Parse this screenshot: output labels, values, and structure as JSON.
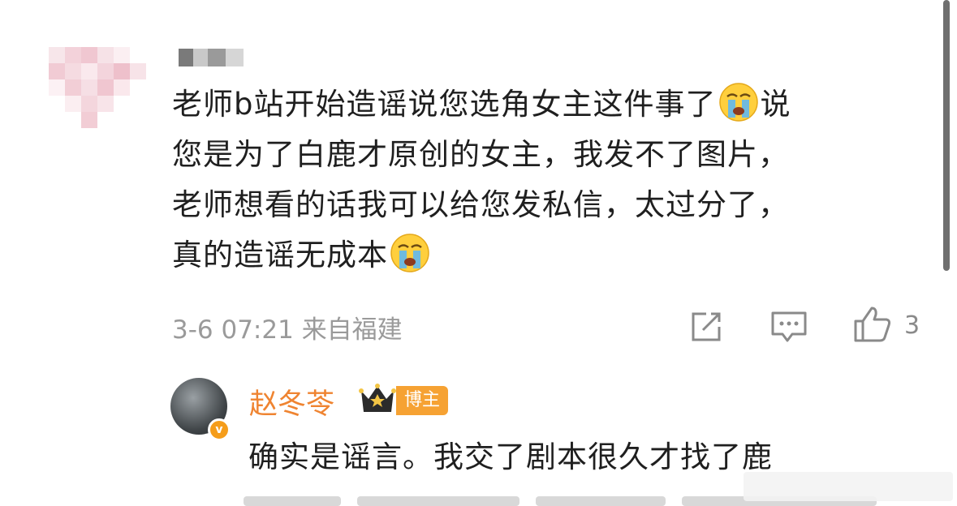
{
  "comment": {
    "text_1": "老师b站开始造谣说您选角女主这件事了",
    "text_2": "说",
    "text_3": "您是为了白鹿才原创的女主，我发不了图片，",
    "text_4": "老师想看的话我可以给您发私信，太过分了，",
    "text_5": "真的造谣无成本",
    "emoji_icon": "crying-face-icon",
    "timestamp": "3-6 07:21",
    "location": "来自福建",
    "like_count": "3"
  },
  "reply": {
    "author": "赵冬苓",
    "badge": "博主",
    "text": "确实是谣言。我交了剧本很久才找了鹿"
  },
  "colors": {
    "author_name": "#ef8431",
    "badge_bg": "#f6a233",
    "meta_text": "#9a9a9a"
  }
}
